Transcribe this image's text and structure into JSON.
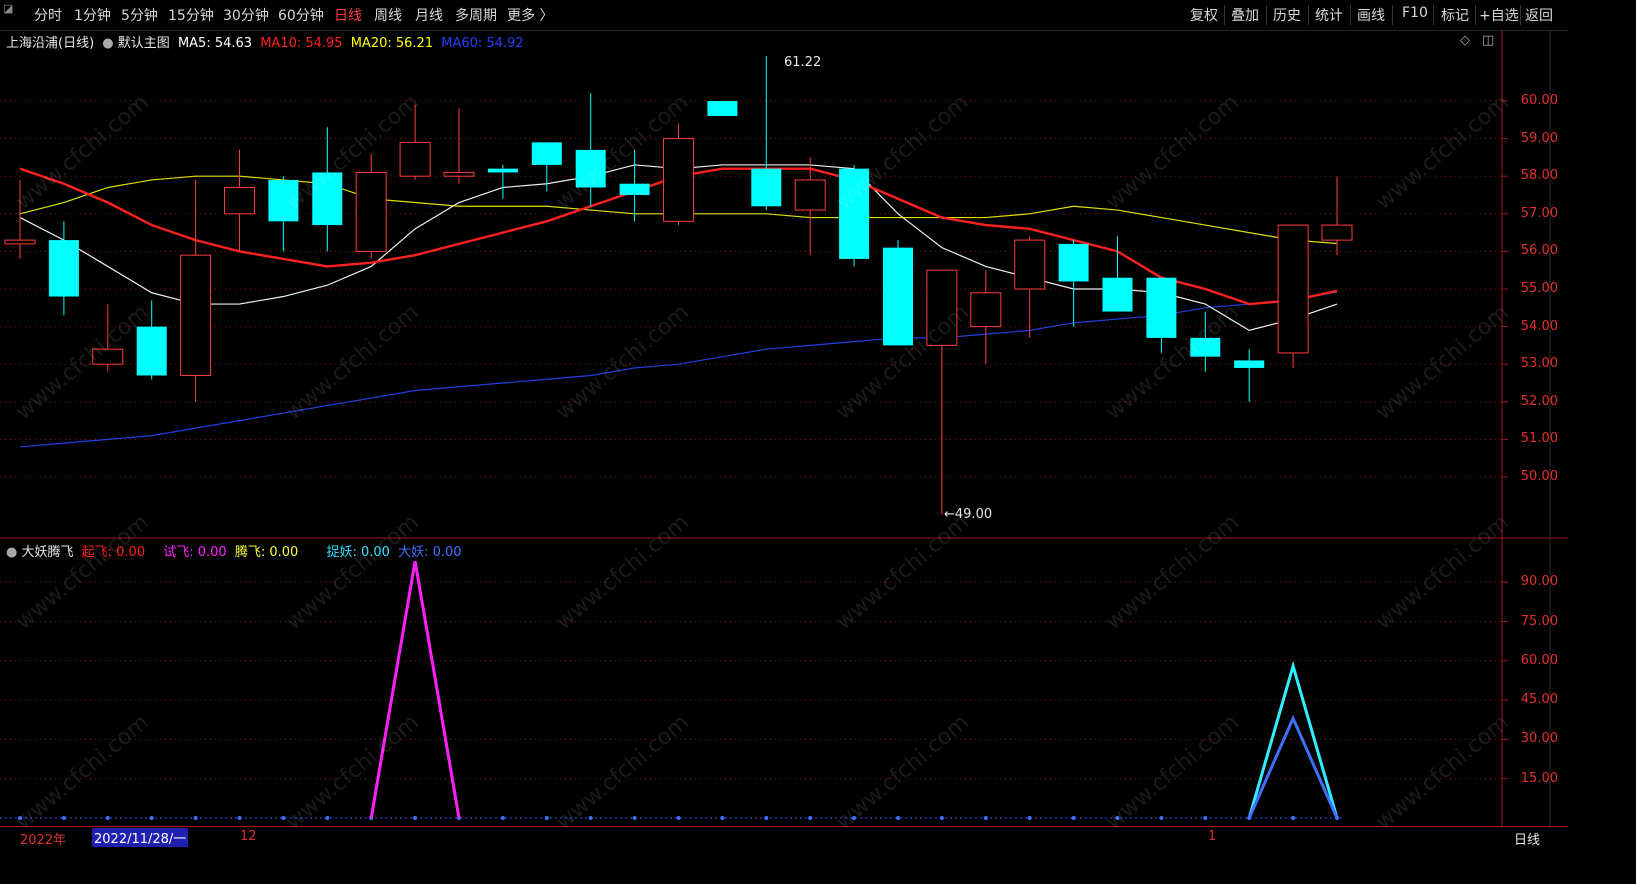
{
  "toolbar": {
    "left_items": [
      "分时",
      "1分钟",
      "5分钟",
      "15分钟",
      "30分钟",
      "60分钟",
      "日线",
      "周线",
      "月线",
      "多周期",
      "更多 〉"
    ],
    "active": "日线",
    "right_items": [
      "复权",
      "叠加",
      "历史",
      "统计",
      "画线",
      "F10",
      "标记",
      "+自选",
      "返回"
    ]
  },
  "main": {
    "stock_title": "上海沿浦(日线)",
    "template": "默认主图",
    "ma": [
      {
        "label": "MA5: 54.63",
        "color": "#ffffff"
      },
      {
        "label": "MA10: 54.95",
        "color": "#ff2020"
      },
      {
        "label": "MA20: 56.21",
        "color": "#ffff00"
      },
      {
        "label": "MA60: 54.92",
        "color": "#2040ff"
      }
    ],
    "price_axis": [
      "60.00",
      "59.00",
      "58.00",
      "57.00",
      "56.00",
      "55.00",
      "54.00",
      "53.00",
      "52.00",
      "51.00",
      "50.00"
    ],
    "high_label": "61.22",
    "low_label": "←49.00",
    "candles": [
      {
        "o": 56.2,
        "c": 56.3,
        "h": 57.9,
        "l": 55.8
      },
      {
        "o": 56.3,
        "c": 54.8,
        "h": 56.8,
        "l": 54.3
      },
      {
        "o": 53.0,
        "c": 53.4,
        "h": 54.6,
        "l": 52.8
      },
      {
        "o": 54.0,
        "c": 52.7,
        "h": 54.7,
        "l": 52.6
      },
      {
        "o": 52.7,
        "c": 55.9,
        "h": 57.9,
        "l": 52.0
      },
      {
        "o": 57.0,
        "c": 57.7,
        "h": 58.7,
        "l": 56.0
      },
      {
        "o": 57.9,
        "c": 56.8,
        "h": 58.0,
        "l": 56.0
      },
      {
        "o": 58.1,
        "c": 56.7,
        "h": 59.3,
        "l": 56.0
      },
      {
        "o": 56.0,
        "c": 58.1,
        "h": 58.6,
        "l": 55.8
      },
      {
        "o": 58.0,
        "c": 58.9,
        "h": 59.9,
        "l": 57.9
      },
      {
        "o": 58.0,
        "c": 58.1,
        "h": 59.8,
        "l": 57.8
      },
      {
        "o": 58.2,
        "c": 58.1,
        "h": 58.3,
        "l": 57.4
      },
      {
        "o": 58.9,
        "c": 58.3,
        "h": 58.9,
        "l": 57.6
      },
      {
        "o": 58.7,
        "c": 57.7,
        "h": 60.2,
        "l": 57.2
      },
      {
        "o": 57.8,
        "c": 57.5,
        "h": 58.7,
        "l": 56.8
      },
      {
        "o": 56.8,
        "c": 59.0,
        "h": 59.4,
        "l": 56.7
      },
      {
        "o": 60.0,
        "c": 59.6,
        "h": 60.0,
        "l": 59.6
      },
      {
        "o": 58.2,
        "c": 57.2,
        "h": 61.2,
        "l": 57.1
      },
      {
        "o": 57.1,
        "c": 57.9,
        "h": 58.5,
        "l": 55.9
      },
      {
        "o": 58.2,
        "c": 55.8,
        "h": 58.3,
        "l": 55.6
      },
      {
        "o": 56.1,
        "c": 53.5,
        "h": 56.3,
        "l": 53.5
      },
      {
        "o": 53.5,
        "c": 55.5,
        "h": 55.5,
        "l": 49.0
      },
      {
        "o": 54.0,
        "c": 54.9,
        "h": 55.5,
        "l": 53.0
      },
      {
        "o": 55.0,
        "c": 56.3,
        "h": 56.4,
        "l": 53.7
      },
      {
        "o": 56.2,
        "c": 55.2,
        "h": 56.3,
        "l": 54.0
      },
      {
        "o": 55.3,
        "c": 54.4,
        "h": 56.4,
        "l": 54.4
      },
      {
        "o": 55.3,
        "c": 53.7,
        "h": 55.3,
        "l": 53.3
      },
      {
        "o": 53.7,
        "c": 53.2,
        "h": 54.4,
        "l": 52.8
      },
      {
        "o": 53.1,
        "c": 52.9,
        "h": 53.4,
        "l": 52.0
      },
      {
        "o": 53.3,
        "c": 56.7,
        "h": 56.7,
        "l": 52.9
      },
      {
        "o": 56.3,
        "c": 56.7,
        "h": 58.0,
        "l": 55.9
      }
    ],
    "ma5": [
      56.9,
      56.3,
      55.6,
      54.9,
      54.6,
      54.6,
      54.8,
      55.1,
      55.6,
      56.6,
      57.3,
      57.7,
      57.8,
      58.0,
      58.3,
      58.2,
      58.3,
      58.3,
      58.3,
      58.2,
      57.0,
      56.1,
      55.6,
      55.3,
      55.0,
      55.0,
      54.9,
      54.6,
      53.9,
      54.2,
      54.6
    ],
    "ma10": [
      58.2,
      57.8,
      57.3,
      56.7,
      56.3,
      56.0,
      55.8,
      55.6,
      55.7,
      55.9,
      56.2,
      56.5,
      56.8,
      57.2,
      57.6,
      58.0,
      58.2,
      58.2,
      58.2,
      57.9,
      57.4,
      56.9,
      56.7,
      56.6,
      56.3,
      56.0,
      55.3,
      55.0,
      54.6,
      54.7,
      54.95
    ],
    "ma20": [
      57.0,
      57.3,
      57.7,
      57.9,
      58.0,
      58.0,
      57.9,
      57.8,
      57.4,
      57.3,
      57.2,
      57.2,
      57.2,
      57.1,
      57.0,
      57.0,
      57.0,
      57.0,
      56.9,
      56.9,
      56.9,
      56.9,
      56.9,
      57.0,
      57.2,
      57.1,
      56.9,
      56.7,
      56.5,
      56.3,
      56.21
    ],
    "ma60": [
      50.8,
      50.9,
      51.0,
      51.1,
      51.3,
      51.5,
      51.7,
      51.9,
      52.1,
      52.3,
      52.4,
      52.5,
      52.6,
      52.7,
      52.9,
      53.0,
      53.2,
      53.4,
      53.5,
      53.6,
      53.7,
      53.7,
      53.8,
      53.9,
      54.1,
      54.2,
      54.3,
      54.5,
      54.6,
      54.7,
      54.92
    ]
  },
  "indicator": {
    "name": "大妖腾飞",
    "items": [
      {
        "label": "起飞: 0.00",
        "color": "#ff2020"
      },
      {
        "label": "试飞: 0.00",
        "color": "#ff20ff"
      },
      {
        "label": "腾飞: 0.00",
        "color": "#ffff40"
      },
      {
        "label": "捉妖: 0.00",
        "color": "#30e0ff"
      },
      {
        "label": "大妖: 0.00",
        "color": "#4070ff"
      }
    ],
    "axis": [
      "90.00",
      "75.00",
      "60.00",
      "45.00",
      "30.00",
      "15.00"
    ],
    "shiFei": {
      "index": 9,
      "value": 98
    },
    "zhuoYao": {
      "index": 29,
      "value": 58
    },
    "daYao": {
      "index": 29,
      "value": 38
    }
  },
  "bottom": {
    "year": "2022年",
    "date_cursor": "2022/11/28/一",
    "month_12": "12",
    "month_1": "1",
    "period_label": "日线"
  },
  "watermark": "www.cfchi.com",
  "colors": {
    "up": "#ff3b3b",
    "down": "#00ffff",
    "grid": "#8a1010"
  }
}
